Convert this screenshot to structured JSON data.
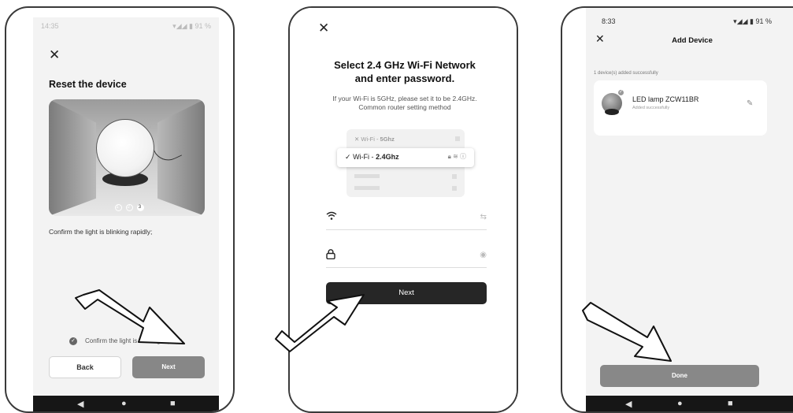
{
  "screen1": {
    "status_time": "14:35",
    "status_icons": "▾◢◢ ▮ 91 %",
    "close_symbol": "✕",
    "title": "Reset the device",
    "pager": [
      "1",
      "2",
      "3"
    ],
    "instruction": "Confirm the light is blinking rapidly;",
    "checkbox_label": "Confirm the light is blinking rapidly;",
    "back_label": "Back",
    "next_label": "Next",
    "nav": {
      "back": "◀",
      "home": "●",
      "recents": "■"
    }
  },
  "screen2": {
    "close_symbol": "✕",
    "title_line1": "Select 2.4 GHz Wi-Fi Network",
    "title_line2": "and enter password.",
    "subtitle_line1": "If your Wi-Fi is 5GHz, please set it to be 2.4GHz.",
    "subtitle_line2": "Common router setting method",
    "wifi_5": {
      "mark": "✕",
      "prefix": "Wi-Fi - ",
      "band": "5Ghz"
    },
    "wifi_24": {
      "mark": "✓",
      "prefix": "Wi-Fi - ",
      "band": "2.4Ghz",
      "icons": "🔒︎ ≋ ⓘ"
    },
    "ssid_icon": "wifi-icon",
    "password_icon": "lock-icon",
    "next_label": "Next"
  },
  "screen3": {
    "status_time": "8:33",
    "status_icons": "▾◢◢ ▮ 91 %",
    "close_symbol": "✕",
    "header": "Add Device",
    "added_summary": "1 device(s) added successfully",
    "device": {
      "name": "LED lamp ZCW11BR",
      "status": "Added successfully"
    },
    "done_label": "Done",
    "nav": {
      "back": "◀",
      "home": "●",
      "recents": "■"
    }
  },
  "colors": {
    "primary_dark": "#262626",
    "disabled_gray": "#878787",
    "screen_bg": "#f3f3f3"
  }
}
